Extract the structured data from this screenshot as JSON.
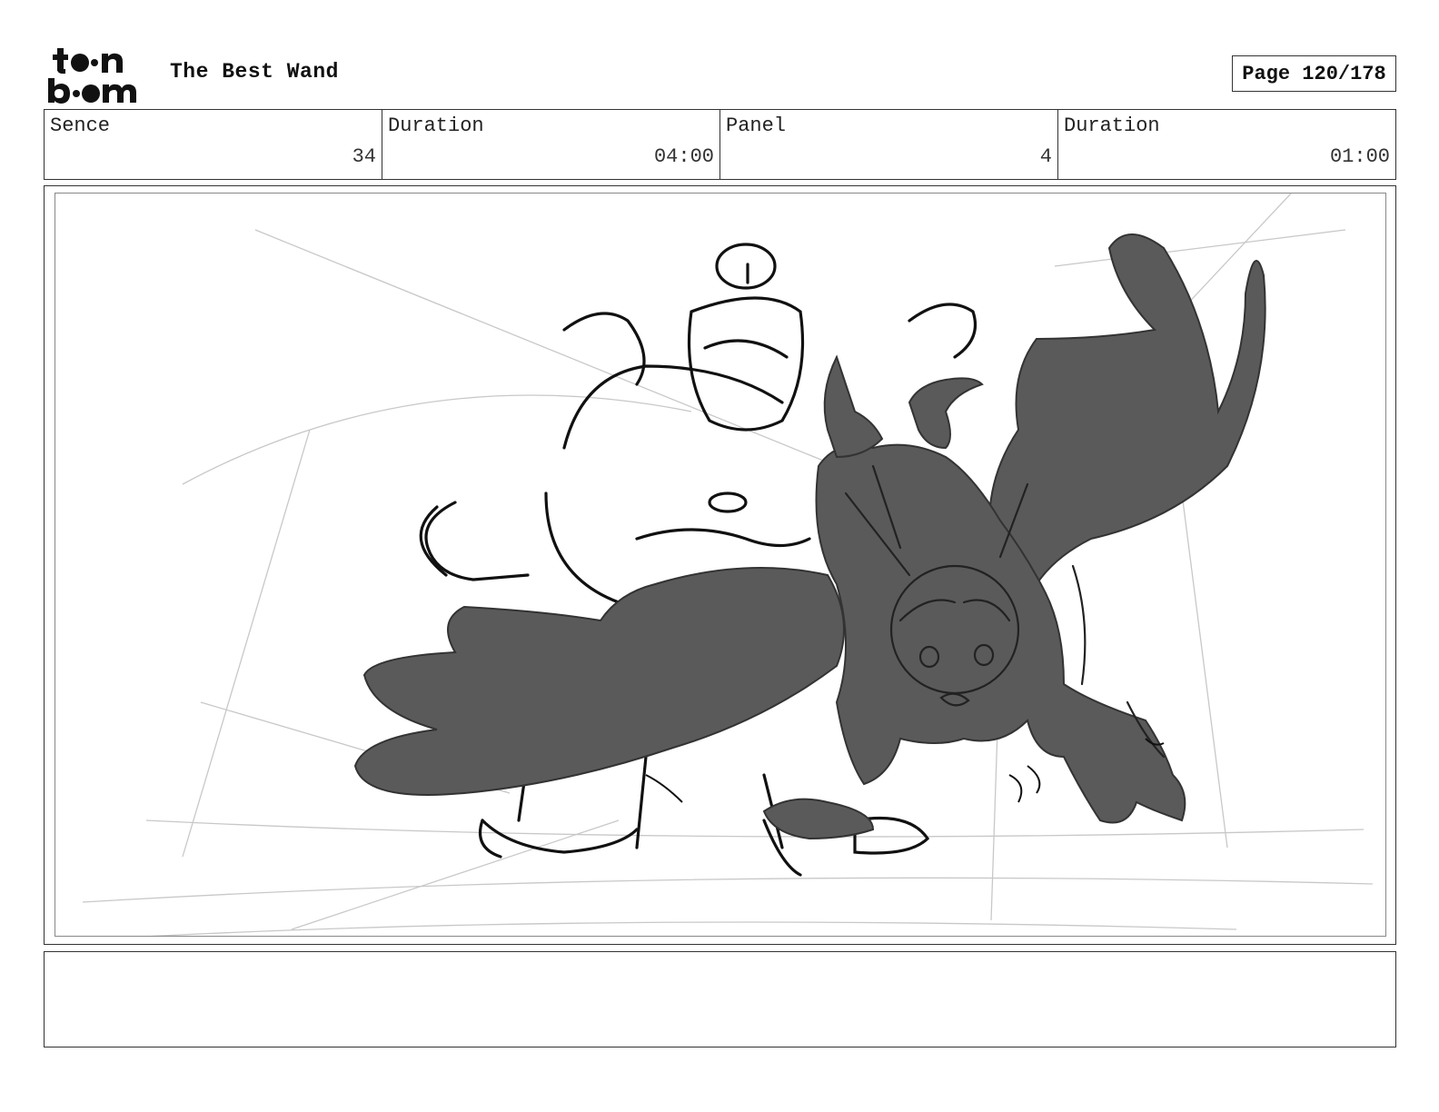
{
  "header": {
    "logo_text": "toon boom",
    "project_title": "The Best Wand",
    "page_label": "Page 120/178"
  },
  "info": [
    {
      "label": "Sence",
      "value": "34"
    },
    {
      "label": "Duration",
      "value": "04:00"
    },
    {
      "label": "Panel",
      "value": "4"
    },
    {
      "label": "Duration",
      "value": "01:00"
    }
  ],
  "panel": {
    "image_subject": "storyboard-sketch",
    "fill_color": "#5a5a5a",
    "line_color": "#111111"
  },
  "notes": {
    "text": ""
  }
}
